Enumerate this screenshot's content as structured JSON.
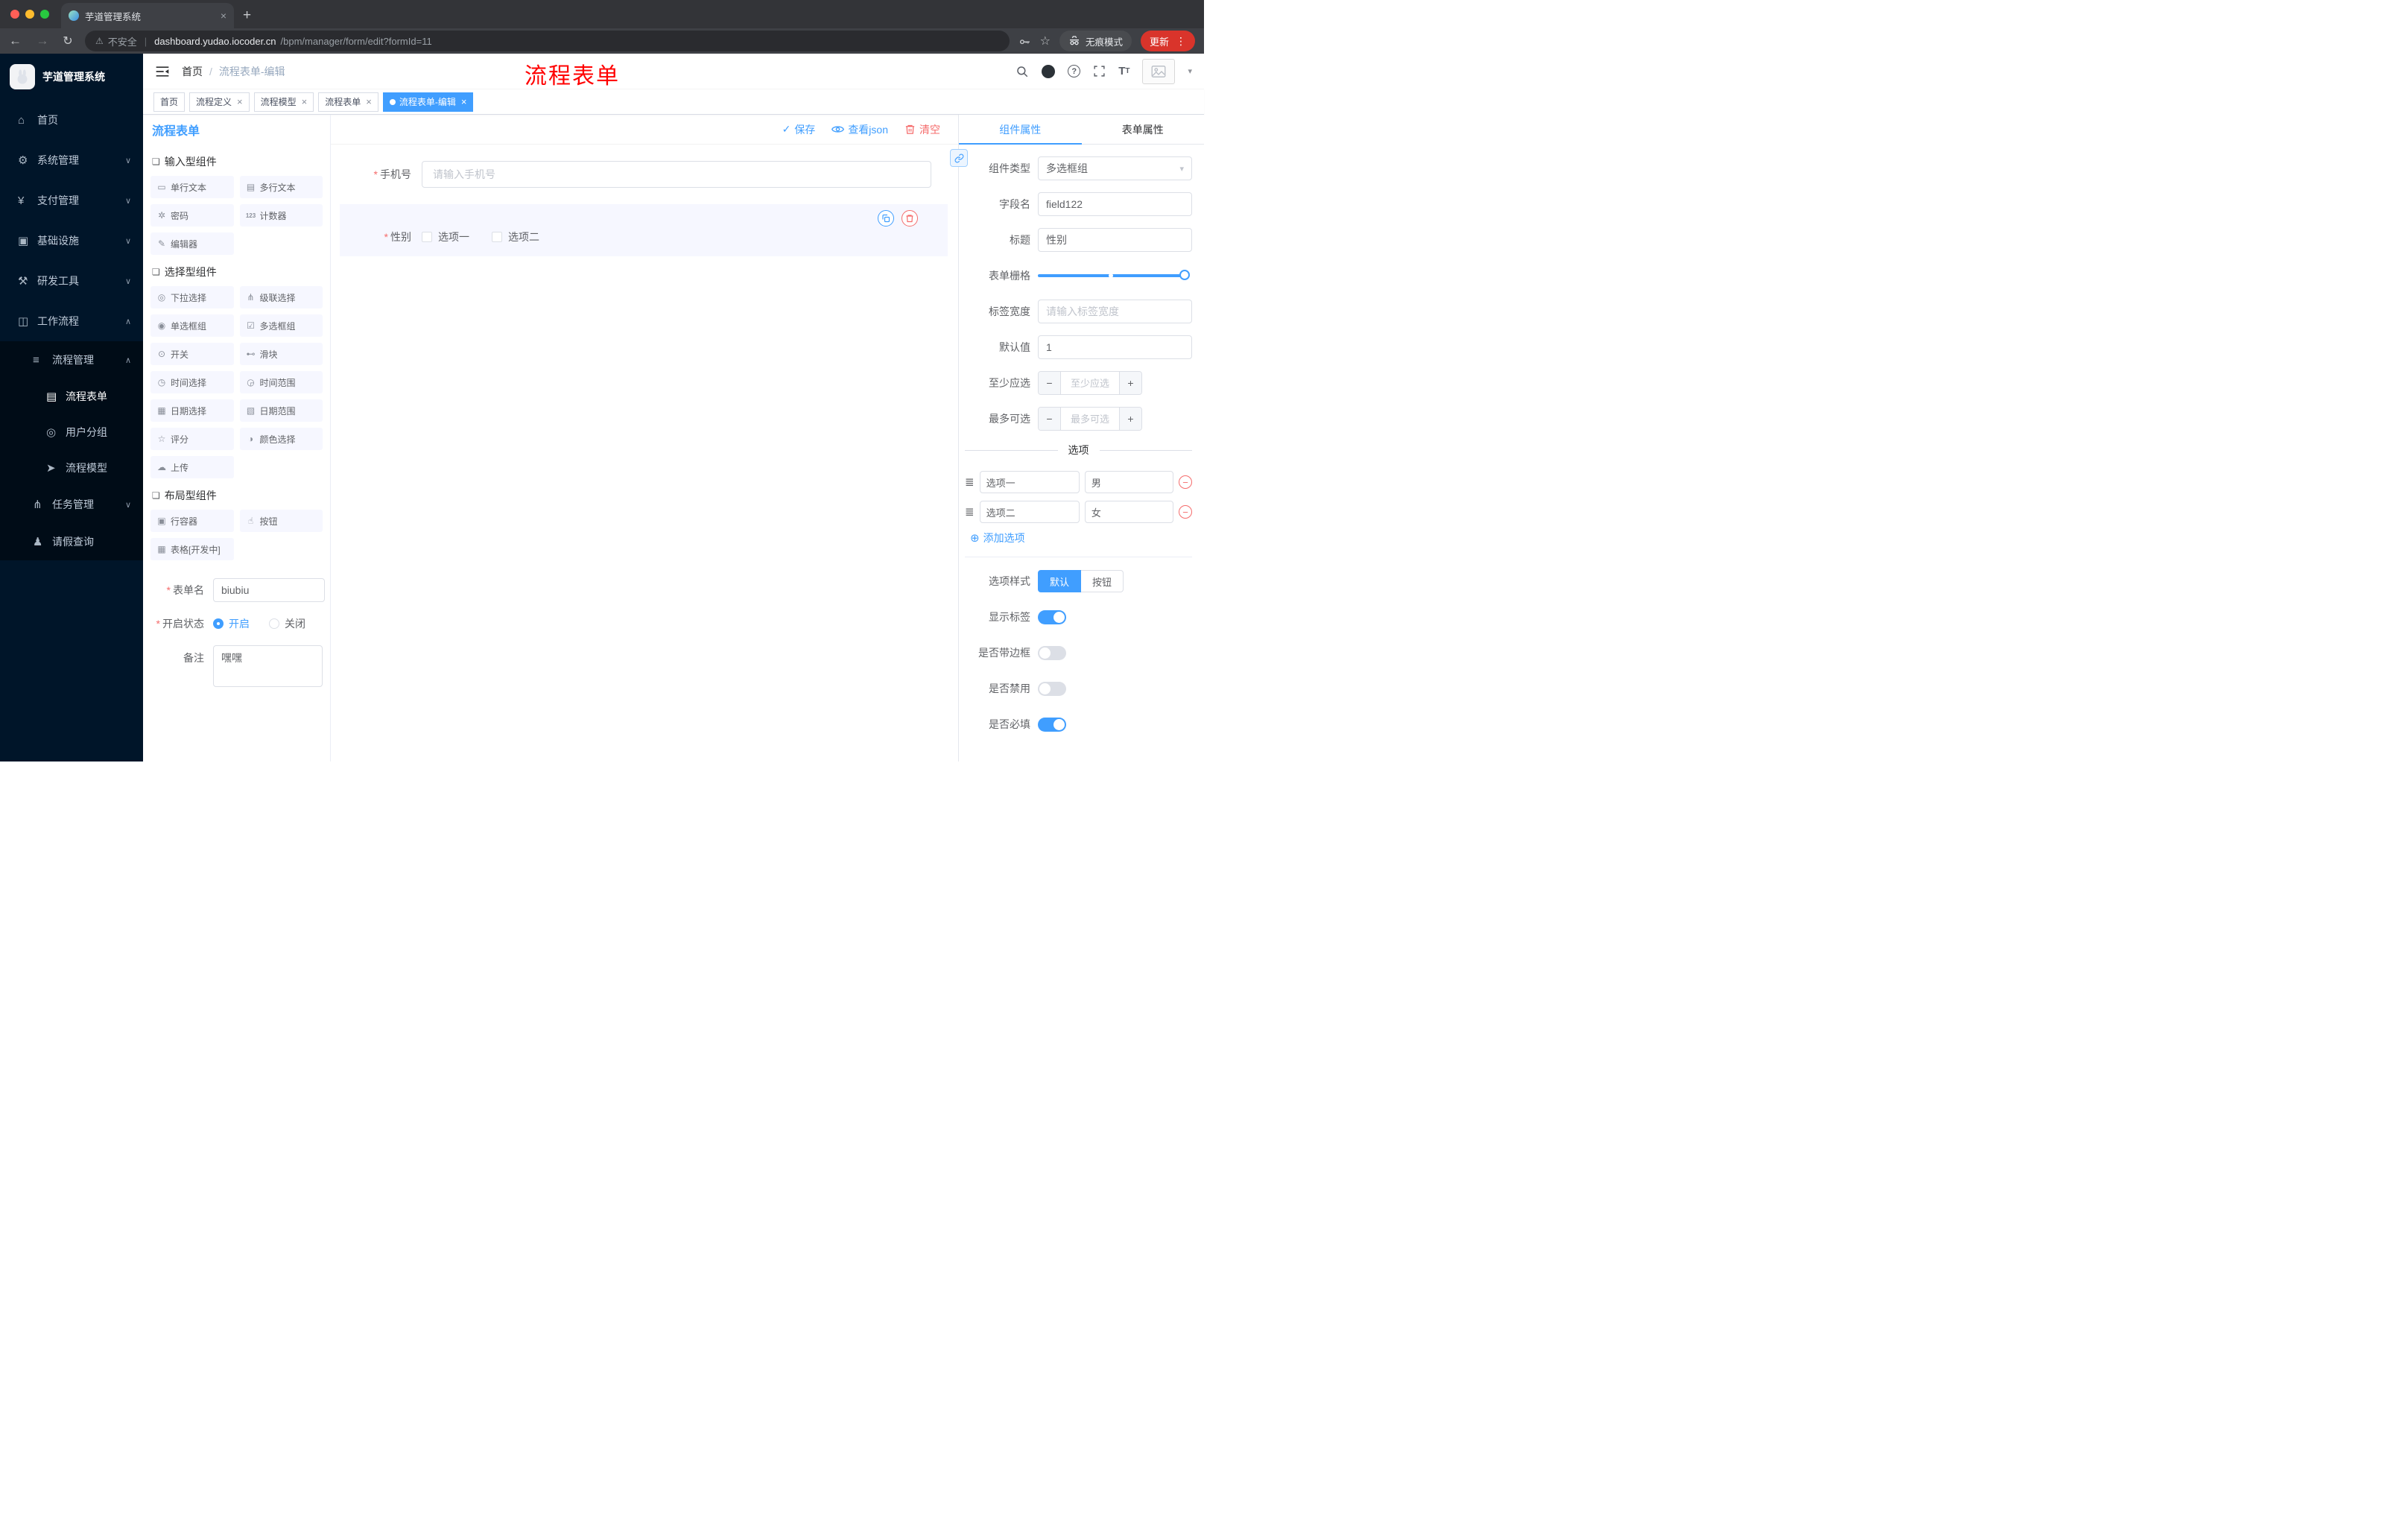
{
  "colors": {
    "primary": "#409eff",
    "danger": "#f56c6c",
    "annotation_red": "#ff0000",
    "sidebar_bg": "#001529"
  },
  "icons": {
    "close": "×",
    "plus": "+",
    "dots": "⋮",
    "back": "←",
    "forward": "→",
    "reload": "↻",
    "star": "☆",
    "warning": "⚠",
    "pipe": "|",
    "caret": "▾",
    "chev_down": "∨",
    "chev_up": "∧",
    "check": "✓",
    "select_arrow": "▾",
    "minus": "−",
    "question": "?",
    "font_big": "T",
    "font_small": "T",
    "group": "❏",
    "add": "⊕",
    "remove": "−",
    "drag": "≣",
    "required": "*"
  },
  "browser": {
    "tab_title": "芋道管理系统",
    "security_label": "不安全",
    "url_domain": "dashboard.yudao.iocoder.cn",
    "url_path": "/bpm/manager/form/edit?formId=11",
    "incognito_label": "无痕模式",
    "update_label": "更新"
  },
  "sidebar": {
    "logo_title": "芋道管理系统",
    "menu": [
      {
        "label": "首页",
        "icon": "⌂"
      },
      {
        "label": "系统管理",
        "icon": "⚙"
      },
      {
        "label": "支付管理",
        "icon": "¥"
      },
      {
        "label": "基础设施",
        "icon": "▣"
      },
      {
        "label": "研发工具",
        "icon": "⚒"
      },
      {
        "label": "工作流程",
        "icon": "◫"
      }
    ],
    "submenu": {
      "parent": {
        "label": "流程管理",
        "icon": "≡"
      },
      "children": [
        {
          "label": "流程表单",
          "icon": "▤"
        },
        {
          "label": "用户分组",
          "icon": "◎"
        },
        {
          "label": "流程模型",
          "icon": "➤"
        }
      ],
      "siblings": [
        {
          "label": "任务管理",
          "icon": "⋔"
        },
        {
          "label": "请假查询",
          "icon": "♟"
        }
      ]
    }
  },
  "navbar": {
    "breadcrumb_home": "首页",
    "breadcrumb_sep": "/",
    "breadcrumb_current": "流程表单-编辑",
    "annotation": "流程表单"
  },
  "tags": [
    {
      "label": "首页"
    },
    {
      "label": "流程定义"
    },
    {
      "label": "流程模型"
    },
    {
      "label": "流程表单"
    },
    {
      "label": "流程表单-编辑"
    }
  ],
  "palette": {
    "panel_title": "流程表单",
    "groups": [
      {
        "title": "输入型组件",
        "items": [
          {
            "label": "单行文本",
            "icon": "▭"
          },
          {
            "label": "多行文本",
            "icon": "▤"
          },
          {
            "label": "密码",
            "icon": "✲"
          },
          {
            "label": "计数器",
            "icon": "123"
          },
          {
            "label": "编辑器",
            "icon": "✎"
          }
        ]
      },
      {
        "title": "选择型组件",
        "items": [
          {
            "label": "下拉选择",
            "icon": "◎"
          },
          {
            "label": "级联选择",
            "icon": "⋔"
          },
          {
            "label": "单选框组",
            "icon": "◉"
          },
          {
            "label": "多选框组",
            "icon": "☑"
          },
          {
            "label": "开关",
            "icon": "⊙"
          },
          {
            "label": "滑块",
            "icon": "⊷"
          },
          {
            "label": "时间选择",
            "icon": "◷"
          },
          {
            "label": "时间范围",
            "icon": "◶"
          },
          {
            "label": "日期选择",
            "icon": "▦"
          },
          {
            "label": "日期范围",
            "icon": "▧"
          },
          {
            "label": "评分",
            "icon": "☆"
          },
          {
            "label": "颜色选择",
            "icon": "◑"
          },
          {
            "label": "上传",
            "icon": "☁"
          }
        ]
      },
      {
        "title": "布局型组件",
        "items": [
          {
            "label": "行容器",
            "icon": "▣"
          },
          {
            "label": "按钮",
            "icon": "☝"
          },
          {
            "label": "表格[开发中]",
            "icon": "▦"
          }
        ]
      }
    ]
  },
  "left_form": {
    "form_name_label": "表单名",
    "form_name_value": "biubiu",
    "status_label": "开启状态",
    "status_on": "开启",
    "status_off": "关闭",
    "remark_label": "备注",
    "remark_value": "嘿嘿"
  },
  "canvas": {
    "toolbar": {
      "save": "保存",
      "view_json": "查看json",
      "clear": "清空"
    },
    "phone_label": "手机号",
    "phone_placeholder": "请输入手机号",
    "gender_label": "性别",
    "gender_options": [
      "选项一",
      "选项二"
    ]
  },
  "props": {
    "tab_component": "组件属性",
    "tab_form": "表单属性",
    "component_type_label": "组件类型",
    "component_type_value": "多选框组",
    "field_name_label": "字段名",
    "field_name_value": "field122",
    "title_label": "标题",
    "title_value": "性别",
    "grid_label": "表单栅格",
    "label_width_label": "标签宽度",
    "label_width_placeholder": "请输入标签宽度",
    "default_label": "默认值",
    "default_value": "1",
    "min_label": "至少应选",
    "min_placeholder": "至少应选",
    "max_label": "最多可选",
    "max_placeholder": "最多可选",
    "options_title": "选项",
    "options": [
      {
        "label": "选项一",
        "value": "男"
      },
      {
        "label": "选项二",
        "value": "女"
      }
    ],
    "add_option": "添加选项",
    "style_label": "选项样式",
    "style_options": [
      "默认",
      "按钮"
    ],
    "show_label_label": "显示标签",
    "border_label": "是否带边框",
    "disabled_label": "是否禁用",
    "required_label": "是否必填"
  }
}
